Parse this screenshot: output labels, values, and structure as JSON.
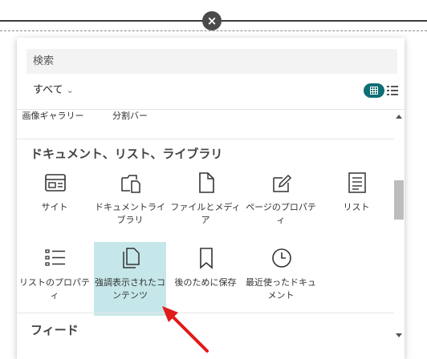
{
  "close_icon_glyph": "×",
  "search": {
    "placeholder": "検索"
  },
  "filter": {
    "label": "すべて",
    "chevron": "⌄"
  },
  "cut_items": [
    {
      "label": "画像ギャラリー"
    },
    {
      "label": "分割バー"
    }
  ],
  "section_document": "ドキュメント、リスト、ライブラリ",
  "tiles": [
    {
      "label": "サイト",
      "icon": "site-icon"
    },
    {
      "label": "ドキュメントライブラリ",
      "icon": "document-library-icon"
    },
    {
      "label": "ファイルとメディア",
      "icon": "file-icon"
    },
    {
      "label": "ページのプロパティ",
      "icon": "edit-icon"
    },
    {
      "label": "リスト",
      "icon": "list-icon"
    },
    {
      "label": "リストのプロパティ",
      "icon": "list-properties-icon"
    },
    {
      "label": "強調表示されたコンテンツ",
      "icon": "highlighted-content-icon",
      "selected": true
    },
    {
      "label": "後のために保存",
      "icon": "bookmark-icon"
    },
    {
      "label": "最近使ったドキュメント",
      "icon": "clock-icon"
    }
  ],
  "section_feed": "フィード",
  "colors": {
    "accent": "#0f6e73",
    "selected_bg": "#c6e7e9",
    "arrow": "#e01b1b"
  }
}
